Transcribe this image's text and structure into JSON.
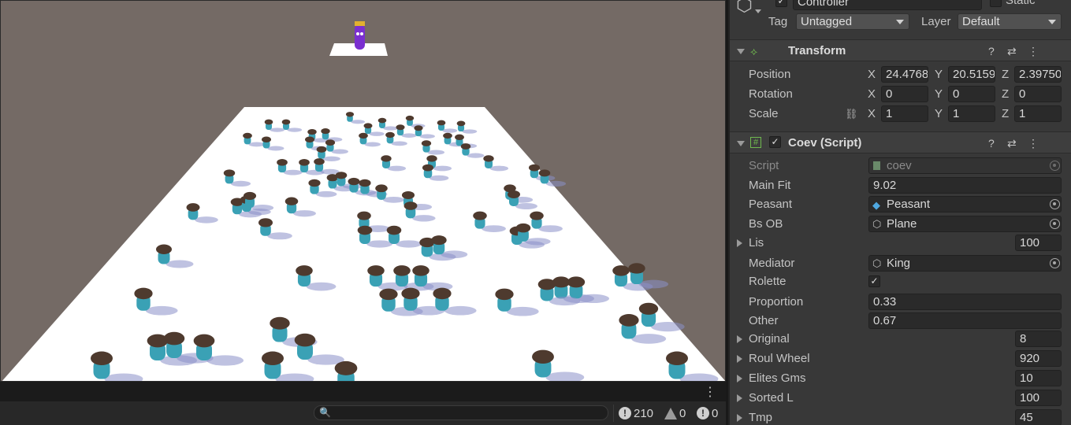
{
  "scene": {
    "king_marker": "crown-king-figure",
    "peasant_marker": "peasant-figure"
  },
  "console": {
    "search_placeholder": "",
    "log_count": "210",
    "warning_count": "0",
    "error_count": "0"
  },
  "inspector": {
    "object_name": "Controller",
    "static_label": "Static",
    "tag_label": "Tag",
    "tag_value": "Untagged",
    "layer_label": "Layer",
    "layer_value": "Default",
    "transform": {
      "title": "Transform",
      "position_label": "Position",
      "rotation_label": "Rotation",
      "scale_label": "Scale",
      "position": {
        "x": "24.4768",
        "y": "20.5159",
        "z": "2.39750"
      },
      "rotation": {
        "x": "0",
        "y": "0",
        "z": "0"
      },
      "scale": {
        "x": "1",
        "y": "1",
        "z": "1"
      },
      "axis_x": "X",
      "axis_y": "Y",
      "axis_z": "Z"
    },
    "coev": {
      "title": "Coev (Script)",
      "fields": [
        {
          "label": "Script",
          "value": "coev"
        },
        {
          "label": "Main Fit",
          "value": "9.02"
        },
        {
          "label": "Peasant",
          "value": "Peasant"
        },
        {
          "label": "Bs OB",
          "value": "Plane"
        },
        {
          "label": "Lis",
          "value": "100"
        },
        {
          "label": "Mediator",
          "value": "King"
        },
        {
          "label": "Rolette",
          "value": "✓"
        },
        {
          "label": "Proportion",
          "value": "0.33"
        },
        {
          "label": "Other",
          "value": "0.67"
        },
        {
          "label": "Original",
          "value": "8"
        },
        {
          "label": "Roul Wheel",
          "value": "920"
        },
        {
          "label": "Elites Gms",
          "value": "10"
        },
        {
          "label": "Sorted L",
          "value": "100"
        },
        {
          "label": "Tmp",
          "value": "45"
        }
      ]
    }
  },
  "colors": {
    "scene_bg": "#746a65",
    "plane": "#ffffff",
    "peasant_body": "#3aa1b5",
    "peasant_hat": "#4e3a2e",
    "king_body": "#7a2fd0",
    "king_crown": "#e0b030"
  }
}
